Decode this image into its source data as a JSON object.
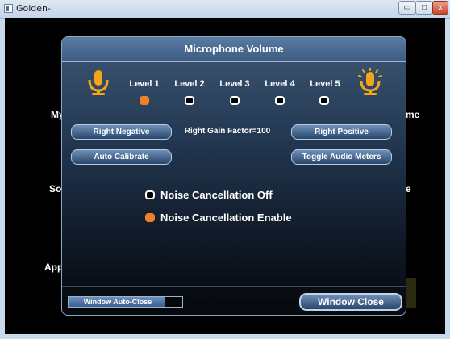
{
  "window": {
    "title": "Golden-i",
    "minimize_glyph": "▭",
    "maximize_glyph": "□",
    "close_glyph": "x"
  },
  "background": {
    "labels": [
      "My",
      "me",
      "So",
      "e",
      "App"
    ]
  },
  "dialog": {
    "title": "Microphone Volume",
    "levels": [
      "Level 1",
      "Level 2",
      "Level 3",
      "Level 4",
      "Level 5"
    ],
    "selected_level_index": 0,
    "buttons": {
      "right_negative": "Right Negative",
      "right_positive": "Right Positive",
      "auto_calibrate": "Auto Calibrate",
      "toggle_audio_meters": "Toggle Audio Meters",
      "window_close": "Window Close"
    },
    "gain_text": "Right Gain Factor=100",
    "noise_options": [
      {
        "label": "Noise Cancellation Off",
        "selected": false
      },
      {
        "label": "Noise Cancellation Enable",
        "selected": true
      }
    ],
    "auto_close": {
      "label": "Window Auto-Close",
      "progress": 0.85
    }
  },
  "colors": {
    "accent_orange": "#f07f2a",
    "mic_yellow": "#f2a71b",
    "button_blue": "#4e6f98"
  },
  "icons": {
    "mic_left": "microphone-icon",
    "mic_right": "microphone-loud-icon"
  }
}
